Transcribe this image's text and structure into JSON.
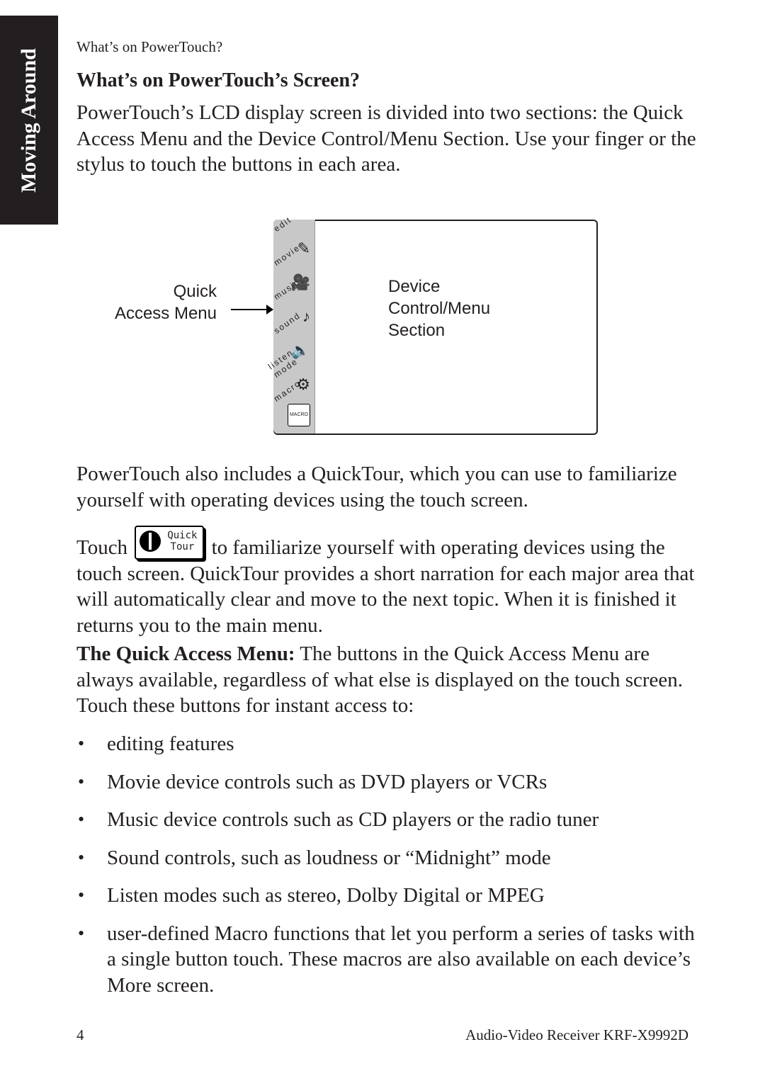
{
  "side_tab": "Moving Around",
  "running_head": "What’s on PowerTouch?",
  "heading": "What’s on PowerTouch’s Screen?",
  "intro": "PowerTouch’s LCD display screen is divided into two sections: the Quick Access Menu and the Device Control/Menu Section. Use your finger or the stylus to touch the buttons in each area.",
  "diagram": {
    "left_label_line1": "Quick",
    "left_label_line2": "Access Menu",
    "right_label_line1": "Device",
    "right_label_line2": "Control/Menu",
    "right_label_line3": "Section",
    "quick_access_items": [
      {
        "label": "edit",
        "icon": "pencil-icon",
        "glyph": "✎"
      },
      {
        "label": "movie",
        "icon": "movie-camera-icon",
        "glyph": "🎥"
      },
      {
        "label": "music",
        "icon": "music-note-icon",
        "glyph": "♪"
      },
      {
        "label": "sound",
        "icon": "speaker-icon",
        "glyph": "🔈"
      },
      {
        "label": "listen mode",
        "icon": "listen-mode-knobs-icon",
        "glyph": "⚙"
      },
      {
        "label": "macro",
        "icon": "macro-button-icon",
        "glyph": "MACRO"
      }
    ]
  },
  "para2": "PowerTouch also includes a QuickTour, which you can use to familiarize yourself with operating devices using the touch screen.",
  "para3_before": "Touch",
  "quicktour_button": {
    "line1": "Quick",
    "line2": "Tour"
  },
  "para3_after": "to familiarize yourself with operating devices using the touch screen. QuickTour provides a short narration for each major area that will automatically clear and move to the next topic. When it is finished it returns you to the main menu.",
  "para4_bold": "The Quick Access Menu:",
  "para4_rest": " The buttons in the Quick Access Menu are always available, regardless of what else is displayed on the touch screen. Touch these buttons for instant access to:",
  "bullets": [
    "editing features",
    "Movie device controls  such as DVD players or VCRs",
    "Music device controls such as CD players or the radio tuner",
    "Sound controls, such as loudness or “Midnight” mode",
    "Listen modes such as stereo, Dolby Digital or MPEG",
    "user-defined Macro functions that let you perform a series of tasks with a single button touch. These macros are also available on each device’s More screen."
  ],
  "footer": {
    "page_number": "4",
    "title": "Audio-Video Receiver KRF-X9992D"
  }
}
